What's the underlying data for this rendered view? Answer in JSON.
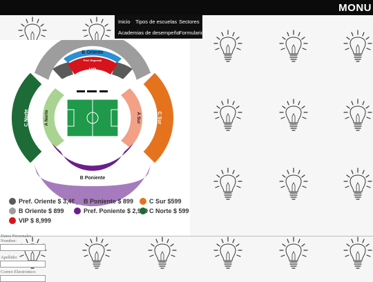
{
  "header": {
    "site_title": "MONU"
  },
  "nav": {
    "items": [
      {
        "label": "Inicio"
      },
      {
        "label": "Tipos de escuelas"
      },
      {
        "label": "Sectores"
      },
      {
        "label": "Academias de desempeño"
      },
      {
        "label": "Formulario"
      }
    ]
  },
  "stadium": {
    "sections": {
      "b_oriente": "B Oriente",
      "pref_especial": "Pref. Especial",
      "vip": "VIP",
      "preferente_oriente_left": "Preferente Oriente",
      "preferente_oriente_right": "Preferente Oriente",
      "c_norte": "C Norte",
      "a_norte": "A Norte",
      "a_sur": "A Sur",
      "c_sur": "C Sur",
      "preferente_poniente": "Preferente Poniente",
      "b_poniente": "B Poniente"
    },
    "legend": [
      {
        "label": "Pref. Oriente",
        "price": "$ 3,499",
        "color": "#5a5a5a"
      },
      {
        "label": "B Oriente",
        "price": "$ 899",
        "color": "#9d9d9d"
      },
      {
        "label": "VIP",
        "price": "$ 8,999",
        "color": "#d7131b"
      },
      {
        "label": "B Poniente",
        "price": "$ 899",
        "color": "#a67bbd"
      },
      {
        "label": "Pref. Poniente",
        "price": "$ 2,999",
        "color": "#6a1f8a"
      },
      {
        "label": "C Sur",
        "price": "$599",
        "color": "#e5731e"
      },
      {
        "label": "C Norte",
        "price": "$ 599",
        "color": "#1d6b36"
      }
    ]
  },
  "form": {
    "section_title": "Datos Personales",
    "name_label": "Nombre:",
    "lastname_label": "Apellido:",
    "email_label": "Correo Electronico:",
    "name_value": "",
    "lastname_value": "",
    "email_value": ""
  }
}
